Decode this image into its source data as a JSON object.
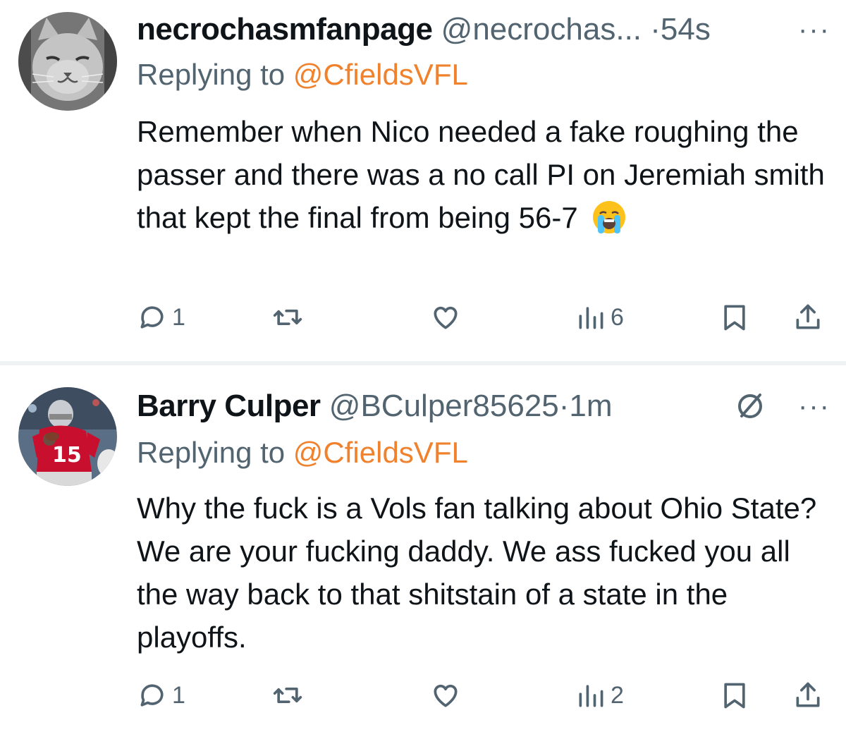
{
  "tweets": [
    {
      "display_name": "necrochasmfanpage",
      "handle": "@necrochas...",
      "separator": "·",
      "time": "54s",
      "more_label": "···",
      "replying_prefix": "Replying to ",
      "replying_to": "@CfieldsVFL",
      "text": "Remember when Nico needed a fake roughing the passer and there was a no call PI on Jeremiah smith that kept the final from being 56-7",
      "emoji": "loudly-crying-face",
      "replies": "1",
      "views": "6",
      "avatar_icon": "cat-avatar-icon"
    },
    {
      "display_name": "Barry Culper",
      "handle": "@BCulper85625",
      "separator": "·",
      "time": "1m",
      "more_label": "···",
      "replying_prefix": "Replying to ",
      "replying_to": "@CfieldsVFL",
      "text": "Why the fuck is a Vols fan talking about Ohio State? We are your fucking daddy. We ass fucked you all the way back to that shitstain of a state in the playoffs.",
      "replies": "1",
      "views": "2",
      "avatar_icon": "football-player-avatar-icon",
      "jersey_number": "15"
    }
  ],
  "colors": {
    "mention": "#f0822d",
    "secondary_text": "#536471",
    "primary_text": "#0f1419",
    "divider": "#eff3f4"
  }
}
